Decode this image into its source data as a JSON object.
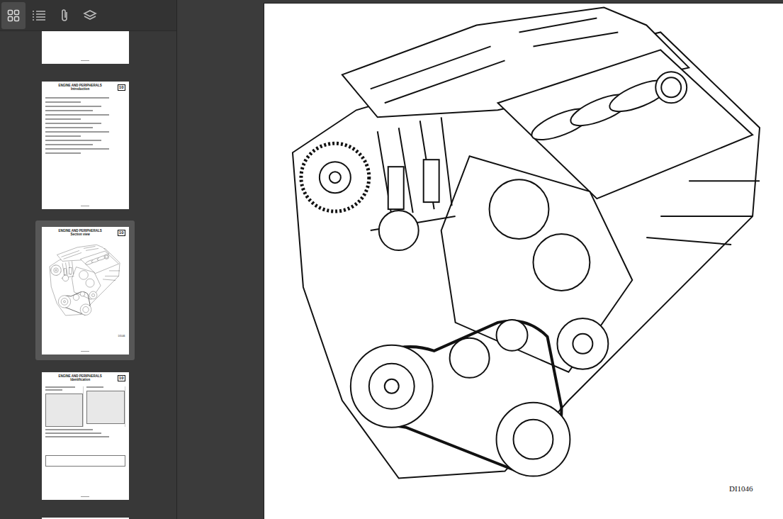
{
  "toolbar": {
    "buttons": [
      {
        "name": "thumbnails",
        "selected": true
      },
      {
        "name": "outline",
        "selected": false
      },
      {
        "name": "attachments",
        "selected": false
      },
      {
        "name": "layers",
        "selected": false
      }
    ]
  },
  "thumbnails": [
    {
      "kind": "partial",
      "title": "",
      "subtitle": "",
      "section": "",
      "selected": false
    },
    {
      "kind": "text",
      "title": "ENGINE AND PERIPHERALS",
      "subtitle": "Introduction",
      "section": "10",
      "selected": false
    },
    {
      "kind": "drawing",
      "title": "ENGINE AND PERIPHERALS",
      "subtitle": "Section view",
      "section": "10",
      "selected": true
    },
    {
      "kind": "figures",
      "title": "ENGINE AND PERIPHERALS",
      "subtitle": "Identification",
      "section": "10",
      "selected": false
    },
    {
      "kind": "partial",
      "title": "",
      "subtitle": "",
      "section": "",
      "selected": false
    }
  ],
  "page": {
    "figure_ref": "DI1046"
  }
}
